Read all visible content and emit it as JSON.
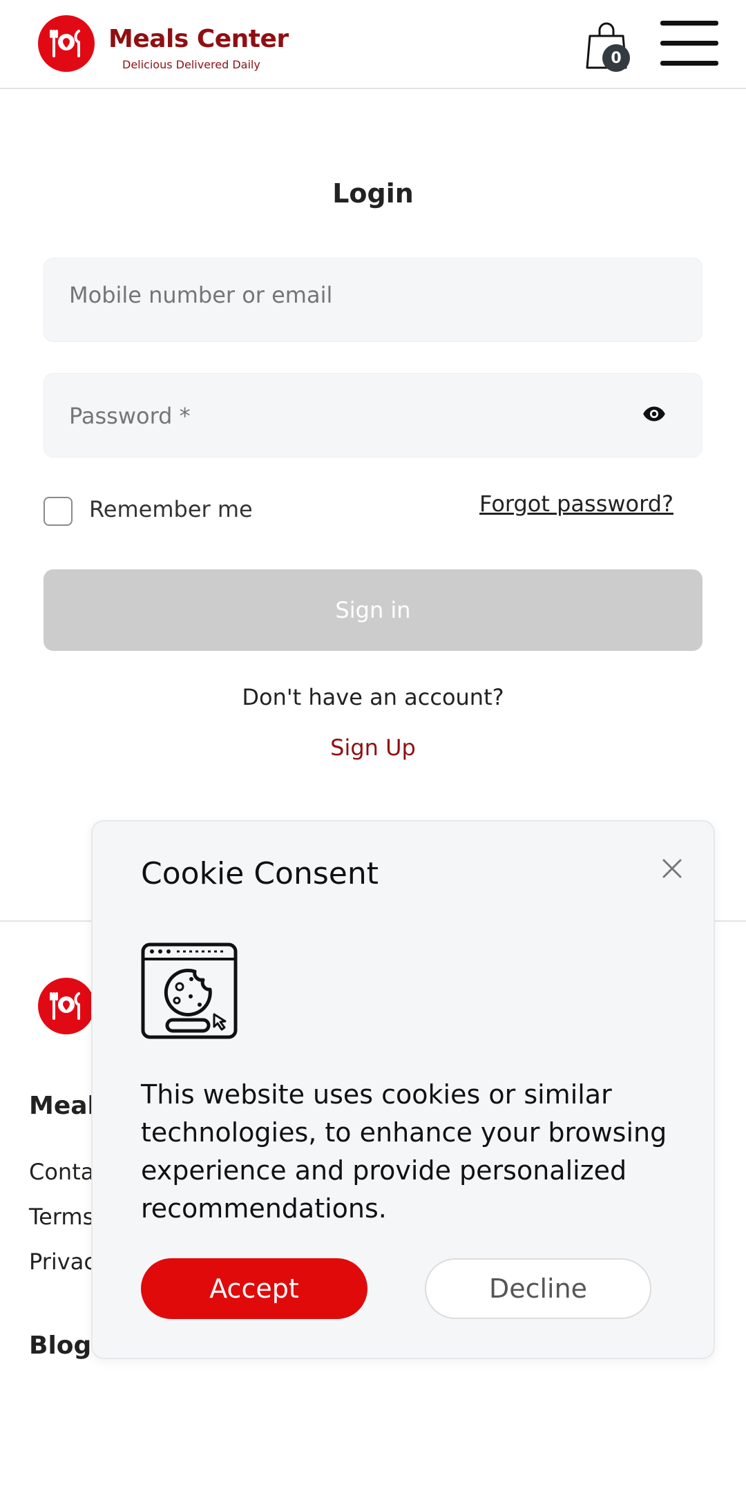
{
  "header": {
    "brand_name": "Meals Center",
    "brand_tagline": "Delicious Delivered Daily",
    "cart_count": "0"
  },
  "login": {
    "title": "Login",
    "email_placeholder": "Mobile number or email",
    "email_value": "",
    "password_placeholder": "Password *",
    "password_value": "",
    "remember_label": "Remember me",
    "forgot_label": "Forgot password?",
    "signin_label": "Sign in",
    "no_account_text": "Don't have an account?",
    "signup_label": "Sign Up"
  },
  "footer": {
    "heading_meals": "Meals",
    "links": [
      "Conta",
      "Terms",
      "Privac"
    ],
    "heading_blog": "Blog"
  },
  "cookie": {
    "title": "Cookie Consent",
    "text": "This website uses cookies or similar technologies, to enhance your browsing experience and provide personalized recommendations.",
    "accept_label": "Accept",
    "decline_label": "Decline"
  },
  "colors": {
    "brand_red": "#e10a14",
    "brand_dark_red": "#8f0f12",
    "disabled_button": "#cccccc",
    "panel_bg": "#f5f6f8"
  },
  "icons": [
    "logo-icon",
    "shopping-bag-icon",
    "hamburger-menu-icon",
    "eye-icon",
    "close-icon",
    "cookie-browser-icon"
  ]
}
